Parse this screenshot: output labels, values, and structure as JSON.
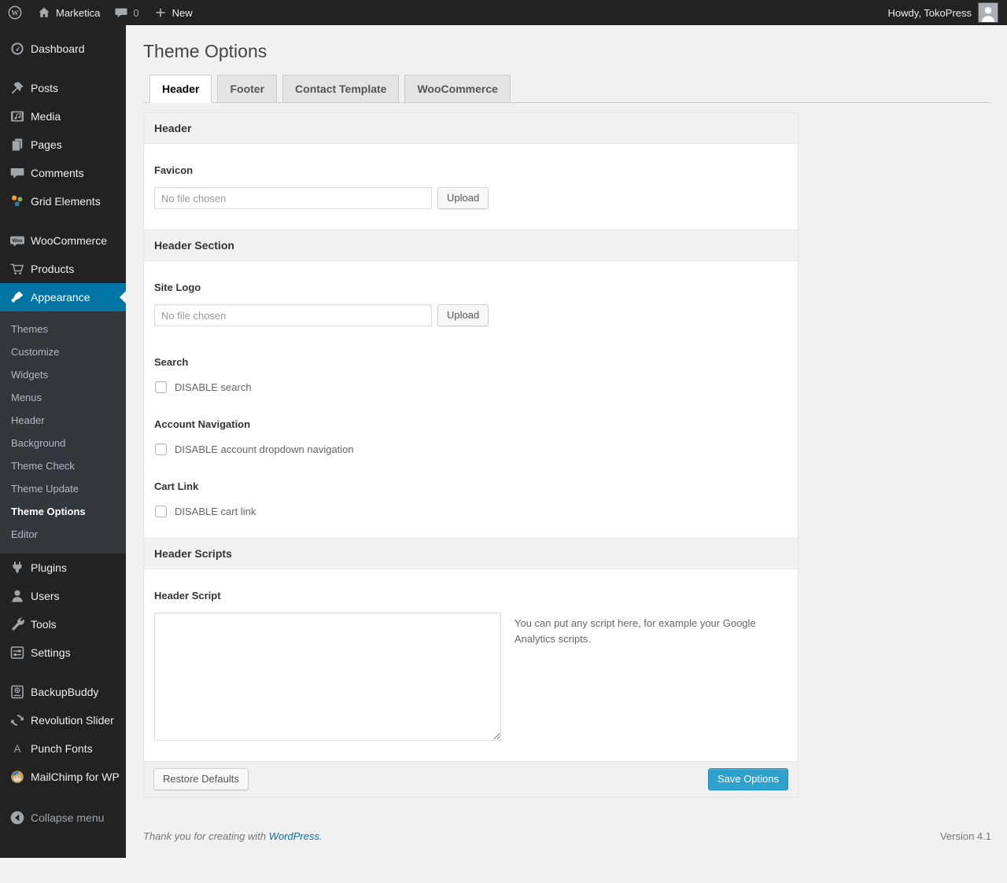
{
  "colors": {
    "accent": "#0074a2",
    "primary_button": "#2ea2cc",
    "link": "#0074a2"
  },
  "admin_bar": {
    "logo_icon": "wordpress-logo-icon",
    "home_icon": "home-icon",
    "site_name": "Marketica",
    "comments_icon": "comment-bubble-icon",
    "comments_count": "0",
    "plus_icon": "plus-icon",
    "new_label": "New",
    "howdy": "Howdy, TokoPress",
    "avatar_icon": "avatar-icon"
  },
  "sidebar": {
    "items": [
      {
        "label": "Dashboard",
        "icon": "dashboard-icon"
      },
      {
        "type": "sep"
      },
      {
        "label": "Posts",
        "icon": "posts-icon"
      },
      {
        "label": "Media",
        "icon": "media-icon"
      },
      {
        "label": "Pages",
        "icon": "pages-icon"
      },
      {
        "label": "Comments",
        "icon": "comments-icon"
      },
      {
        "label": "Grid Elements",
        "icon": "grid-elements-icon"
      },
      {
        "type": "sep"
      },
      {
        "label": "WooCommerce",
        "icon": "woocommerce-icon"
      },
      {
        "label": "Products",
        "icon": "products-icon"
      },
      {
        "label": "Appearance",
        "icon": "appearance-icon",
        "active": true,
        "submenu": [
          {
            "label": "Themes"
          },
          {
            "label": "Customize"
          },
          {
            "label": "Widgets"
          },
          {
            "label": "Menus"
          },
          {
            "label": "Header"
          },
          {
            "label": "Background"
          },
          {
            "label": "Theme Check"
          },
          {
            "label": "Theme Update"
          },
          {
            "label": "Theme Options",
            "current": true
          },
          {
            "label": "Editor"
          }
        ]
      },
      {
        "label": "Plugins",
        "icon": "plugins-icon"
      },
      {
        "label": "Users",
        "icon": "users-icon"
      },
      {
        "label": "Tools",
        "icon": "tools-icon"
      },
      {
        "label": "Settings",
        "icon": "settings-icon"
      },
      {
        "type": "sep"
      },
      {
        "label": "BackupBuddy",
        "icon": "backupbuddy-icon"
      },
      {
        "label": "Revolution Slider",
        "icon": "revolution-slider-icon"
      },
      {
        "label": "Punch Fonts",
        "icon": "punch-fonts-icon"
      },
      {
        "label": "MailChimp for WP",
        "icon": "mailchimp-icon"
      },
      {
        "label": "Collapse menu",
        "icon": "collapse-icon",
        "collapse": true
      }
    ]
  },
  "main": {
    "page_title": "Theme Options",
    "tabs": [
      {
        "label": "Header",
        "active": true
      },
      {
        "label": "Footer",
        "active": false
      },
      {
        "label": "Contact Template",
        "active": false
      },
      {
        "label": "WooCommerce",
        "active": false
      }
    ],
    "sections": {
      "header": "Header",
      "header_section": "Header Section",
      "header_scripts": "Header Scripts"
    },
    "fields": {
      "favicon": {
        "label": "Favicon",
        "placeholder": "No file chosen",
        "button": "Upload"
      },
      "site_logo": {
        "label": "Site Logo",
        "placeholder": "No file chosen",
        "button": "Upload"
      },
      "search": {
        "label": "Search",
        "checkbox_label": "DISABLE search",
        "checked": false
      },
      "account_nav": {
        "label": "Account Navigation",
        "checkbox_label": "DISABLE account dropdown navigation",
        "checked": false
      },
      "cart_link": {
        "label": "Cart Link",
        "checkbox_label": "DISABLE cart link",
        "checked": false
      },
      "header_script": {
        "label": "Header Script",
        "value": "",
        "help": "You can put any script here, for example your Google Analytics scripts."
      }
    },
    "actions": {
      "restore": "Restore Defaults",
      "save": "Save Options"
    }
  },
  "footer": {
    "thanks_prefix": "Thank you for creating with ",
    "wordpress_link": "WordPress",
    "thanks_suffix": ".",
    "version": "Version 4.1"
  }
}
